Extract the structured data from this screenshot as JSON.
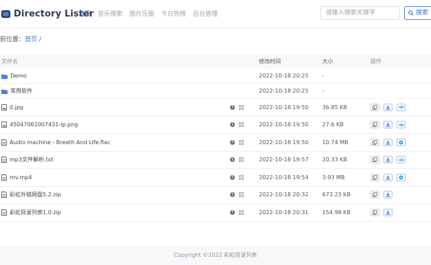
{
  "header": {
    "logo_text": "Directory Lister",
    "nav": [
      "首页",
      "音乐搜索",
      "图片压缩",
      "今日热榜",
      "后台管理"
    ],
    "search_placeholder": "请输入搜索关键字",
    "search_button": "搜索"
  },
  "breadcrumb": {
    "prefix": "前位置：",
    "home": "首页",
    "sep": "/"
  },
  "table": {
    "headers": {
      "name": "文件名",
      "time": "修改时间",
      "size": "大小",
      "ops": "操作"
    },
    "rows": [
      {
        "name": "Demo",
        "time": "2022-10-18 20:25",
        "size": "-",
        "kind": "folder"
      },
      {
        "name": "常用软件",
        "time": "2022-10-18 20:25",
        "size": "-",
        "kind": "folder"
      },
      {
        "name": "0.jpg",
        "time": "2022-10-18 19:50",
        "size": "36.85 KB",
        "kind": "image",
        "ops": [
          "copy",
          "download",
          "view"
        ]
      },
      {
        "name": "45047061007431-lp.png",
        "time": "2022-10-18 19:50",
        "size": "27.6 KB",
        "kind": "image",
        "ops": [
          "copy",
          "download",
          "view"
        ]
      },
      {
        "name": "Audio machine - Breath And Life.flac",
        "time": "2022-10-18 19:50",
        "size": "10.74 MB",
        "kind": "file",
        "ops": [
          "copy",
          "download",
          "play"
        ]
      },
      {
        "name": "mp3文件解析.txt",
        "time": "2022-10-18 19:57",
        "size": "20.33 KB",
        "kind": "file",
        "ops": [
          "copy",
          "download",
          "view"
        ]
      },
      {
        "name": "mv.mp4",
        "time": "2022-10-18 19:54",
        "size": "3.93 MB",
        "kind": "file",
        "ops": [
          "copy",
          "download",
          "play"
        ]
      },
      {
        "name": "彩虹外链网盘5.2.zip",
        "time": "2022-10-18 20:32",
        "size": "673.23 KB",
        "kind": "file",
        "ops": [
          "copy",
          "download"
        ]
      },
      {
        "name": "彩虹目录列表1.0.zip",
        "time": "2022-10-18 20:31",
        "size": "154.98 KB",
        "kind": "file",
        "ops": [
          "copy",
          "download"
        ]
      }
    ]
  },
  "footer": {
    "copyright": "Copyright ©2022 彩虹目录列表"
  }
}
